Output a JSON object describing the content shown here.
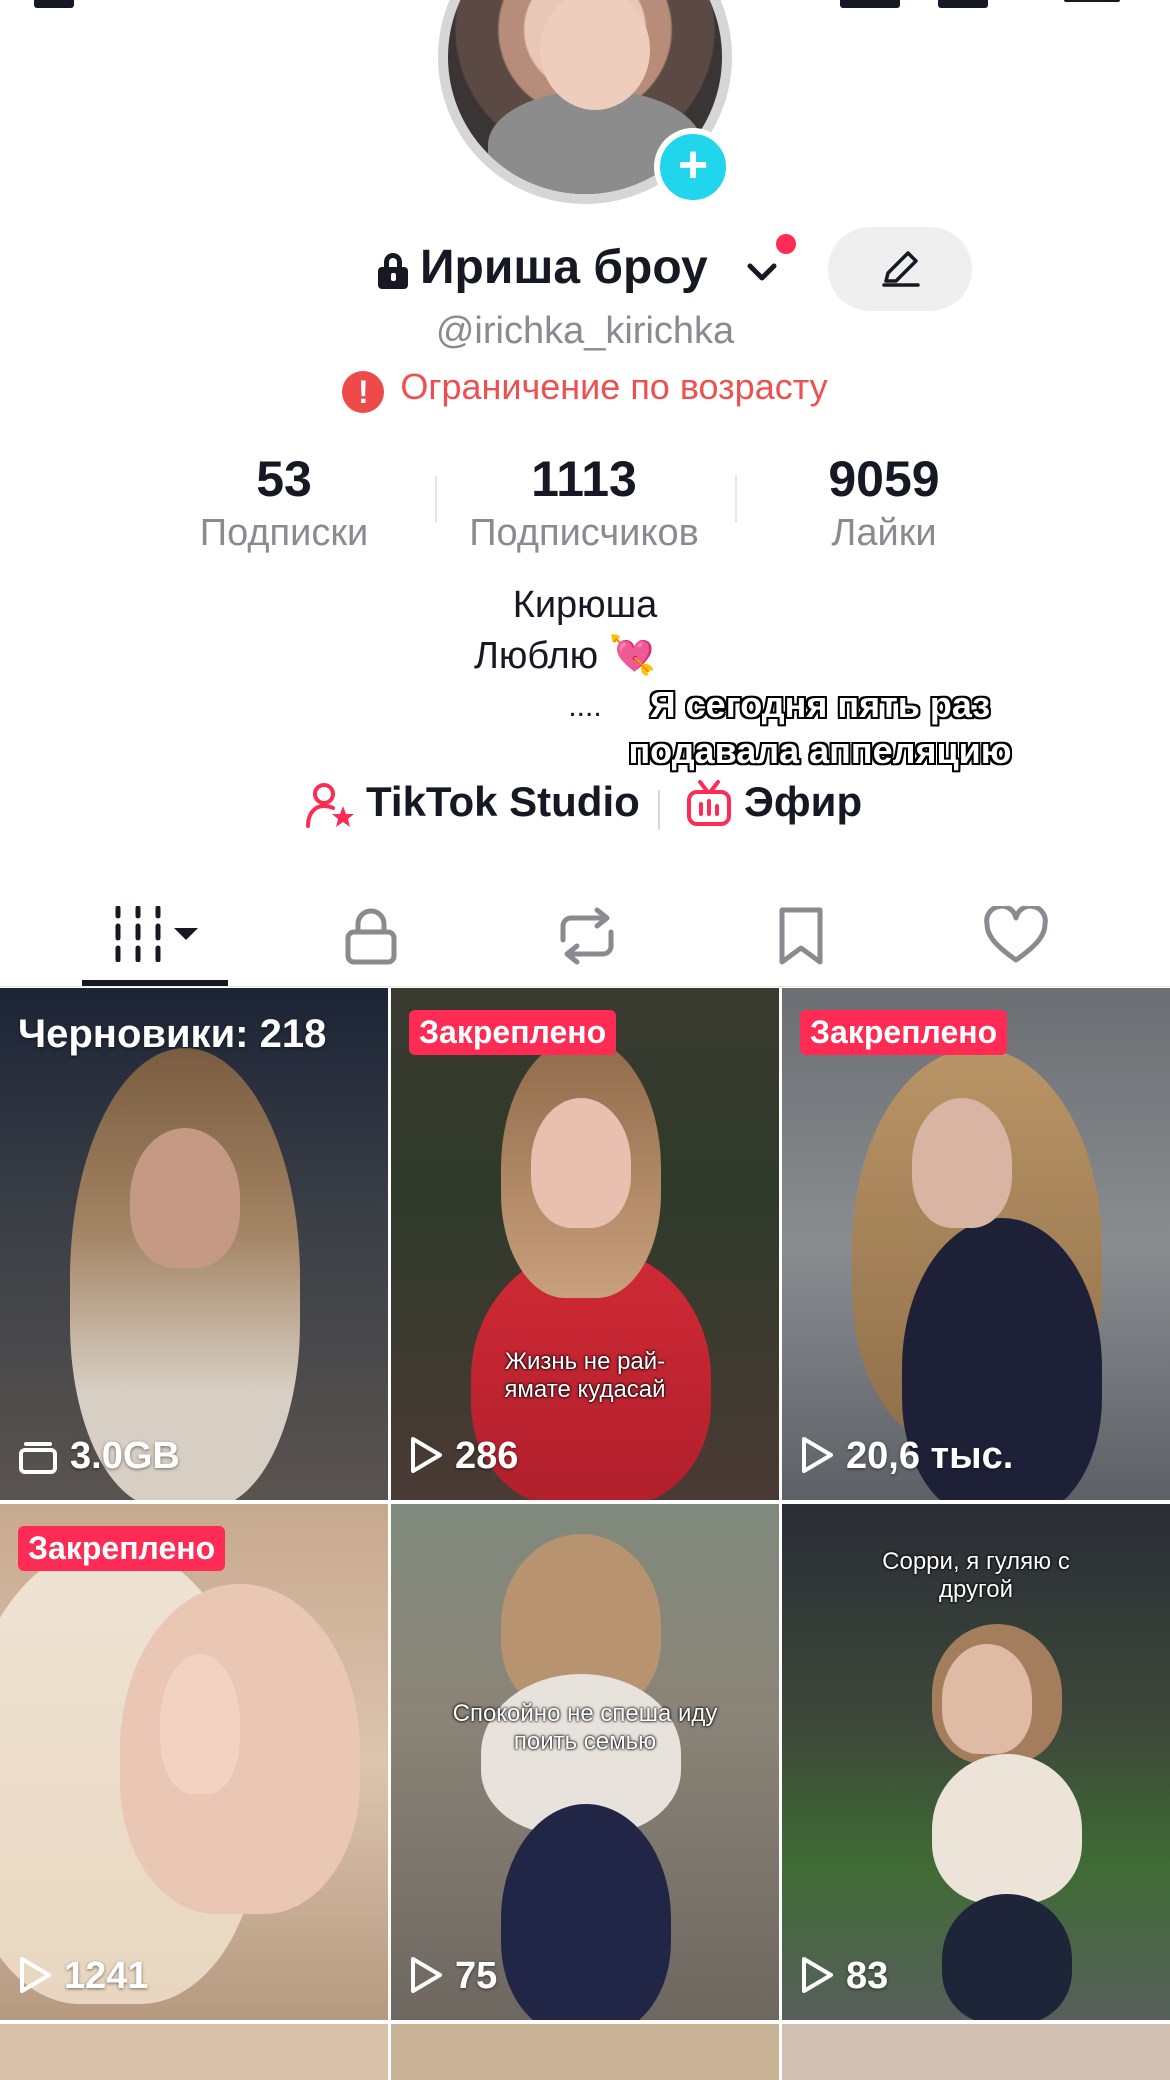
{
  "profile": {
    "display_name": "Ириша броу",
    "username": "@irichka_kirichka",
    "age_restriction": "Ограничение по возрасту"
  },
  "stats": [
    {
      "value": "53",
      "label": "Подписки"
    },
    {
      "value": "1113",
      "label": "Подписчиков"
    },
    {
      "value": "9059",
      "label": "Лайки"
    }
  ],
  "bio": {
    "line1": "Кирюша",
    "line2": "Люблю 💘",
    "line3": "....",
    "overlay_line1": "Я сегодня пять раз",
    "overlay_line2": "подавала аппеляцию"
  },
  "links": {
    "studio": "TikTok Studio",
    "live": "Эфир"
  },
  "tabs": [
    "videos",
    "private",
    "reposts",
    "favorites",
    "liked"
  ],
  "colors": {
    "accent": "#fe2c55",
    "add": "#20d5ec",
    "warning": "#ef4f4f"
  },
  "grid": [
    {
      "label": "Черновики: 218",
      "count": "3.0GB",
      "kind": "drafts"
    },
    {
      "badge": "Закреплено",
      "count": "286",
      "caption": "Жизнь не рай-\nямате кудасай"
    },
    {
      "badge": "Закреплено",
      "count": "20,6 тыс."
    },
    {
      "badge": "Закреплено",
      "count": "1241"
    },
    {
      "count": "75",
      "caption": "Спокойно не спеша иду\nпоить семью"
    },
    {
      "count": "83",
      "caption": "Сорри, я гуляю с\nдругой"
    }
  ]
}
